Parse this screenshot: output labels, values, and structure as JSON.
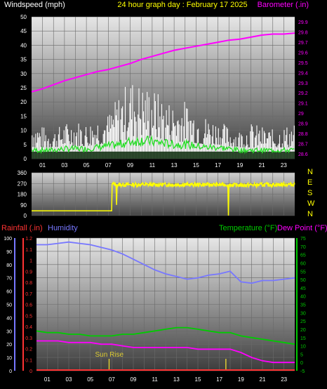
{
  "title": "24 hour graph day : February 17 2025",
  "colors": {
    "background": "#000000",
    "title": "#ffff00",
    "wind_axis": "#ffffff",
    "barometer": "#ff00ff",
    "direction": "#ffff00",
    "rainfall": "#ff3333",
    "humidity": "#7777ff",
    "temperature": "#00cc00",
    "dew_point": "#ff00ff",
    "gust": "#ffffff",
    "avg_wind": "#22dd22",
    "wind_dark": "#0a2a0a",
    "sunrise": "#ddcc33"
  },
  "x_tick_labels": [
    "01",
    "03",
    "05",
    "07",
    "09",
    "11",
    "13",
    "15",
    "17",
    "19",
    "21",
    "23"
  ],
  "chart_data": [
    {
      "type": "line",
      "name": "wind-barometer",
      "left_axis_label": "Windspeed (mph)",
      "right_axis_label": "Barometer (.in)",
      "left_ticks": [
        "0",
        "5",
        "10",
        "15",
        "20",
        "25",
        "30",
        "35",
        "40",
        "45",
        "50"
      ],
      "right_ticks": [
        "28.6",
        "28.7",
        "28.8",
        "28.9",
        "29",
        "29.1",
        "29.2",
        "29.3",
        "29.4",
        "29.5",
        "29.6",
        "29.7",
        "29.8",
        "29.9"
      ],
      "ylim_left": [
        0,
        50
      ],
      "ylim_right": [
        28.55,
        29.95
      ],
      "x_hours": [
        0,
        1,
        2,
        3,
        4,
        5,
        6,
        7,
        8,
        9,
        10,
        11,
        12,
        13,
        14,
        15,
        16,
        17,
        18,
        19,
        20,
        21,
        22,
        23,
        24
      ],
      "series": [
        {
          "name": "Barometer (.in)",
          "axis": "right",
          "values": [
            29.21,
            29.24,
            29.28,
            29.32,
            29.35,
            29.38,
            29.41,
            29.43,
            29.46,
            29.49,
            29.53,
            29.56,
            29.59,
            29.62,
            29.64,
            29.66,
            29.68,
            29.7,
            29.72,
            29.73,
            29.75,
            29.77,
            29.78,
            29.78,
            29.79
          ]
        },
        {
          "name": "Wind gust (mph)",
          "axis": "left",
          "values": [
            12,
            10,
            9,
            11,
            12,
            11,
            13,
            14,
            20,
            25,
            23,
            22,
            19,
            17,
            18,
            15,
            13,
            12,
            10,
            9,
            11,
            10,
            9,
            10,
            11
          ]
        },
        {
          "name": "Average wind (mph)",
          "axis": "left",
          "values": [
            3,
            3,
            3,
            3.5,
            3.5,
            3.5,
            4,
            4.5,
            5,
            6,
            6.5,
            6,
            5.5,
            5,
            5,
            4.5,
            4,
            4,
            3.5,
            3,
            3,
            3,
            3,
            3,
            3
          ]
        }
      ]
    },
    {
      "type": "line",
      "name": "wind-direction",
      "left_ticks": [
        "0",
        "90",
        "180",
        "270",
        "360"
      ],
      "right_ticks": [
        "N",
        "W",
        "S",
        "E",
        "N"
      ],
      "ylim": [
        0,
        360
      ],
      "series": [
        {
          "name": "Wind direction (deg)",
          "points": [
            [
              0,
              40
            ],
            [
              7.3,
              40
            ],
            [
              7.35,
              265
            ],
            [
              7.7,
              265
            ],
            [
              7.75,
              90
            ],
            [
              7.8,
              260
            ],
            [
              17.9,
              260
            ],
            [
              17.95,
              0
            ],
            [
              18.0,
              255
            ],
            [
              24,
              262
            ]
          ]
        }
      ]
    },
    {
      "type": "line",
      "name": "temp-humidity-rain",
      "left_axis_label_1": "Rainfall (.in)",
      "left_axis_label_2": "Humidity",
      "right_axis_label_1": "Temperature (°F)",
      "right_axis_label_2": "Dew Point (°F)",
      "humidity_ticks": [
        "0",
        "10",
        "20",
        "30",
        "40",
        "50",
        "60",
        "70",
        "80",
        "90",
        "100"
      ],
      "rain_ticks": [
        "0",
        "0.1",
        "0.2",
        "0.3",
        "0.4",
        "0.5",
        "0.6",
        "0.7",
        "0.8",
        "0.9",
        "1",
        "1.1",
        "1.2"
      ],
      "temp_ticks": [
        "-5",
        "0",
        "5",
        "10",
        "15",
        "20",
        "25",
        "30",
        "35",
        "40",
        "45",
        "50",
        "55",
        "60",
        "65",
        "70",
        "75"
      ],
      "ylim_humidity": [
        0,
        100
      ],
      "ylim_temperature": [
        -5,
        75
      ],
      "annotation": "Sun Rise",
      "sunrise_hour": 6.75,
      "sunset_hour": 17.6,
      "x_hours": [
        0,
        1,
        2,
        3,
        4,
        5,
        6,
        7,
        8,
        9,
        10,
        11,
        12,
        13,
        14,
        15,
        16,
        17,
        18,
        19,
        20,
        21,
        22,
        23,
        24
      ],
      "series": [
        {
          "name": "Humidity",
          "axis": "humidity",
          "values": [
            95,
            95,
            96,
            97,
            96,
            95,
            93,
            91,
            88,
            84,
            80,
            76,
            73,
            71,
            69,
            70,
            72,
            73,
            75,
            67,
            66,
            68,
            68,
            69,
            70
          ]
        },
        {
          "name": "Temperature (°F)",
          "axis": "temperature",
          "values": [
            19,
            18,
            18,
            17,
            17,
            16,
            16,
            16,
            17,
            17,
            18,
            19,
            20,
            21,
            21,
            20,
            19,
            18,
            18,
            16,
            15,
            14,
            13,
            12,
            11
          ]
        },
        {
          "name": "Dew Point (°F)",
          "axis": "temperature",
          "values": [
            13,
            13,
            13,
            12,
            12,
            12,
            11,
            11,
            10,
            9,
            9,
            9,
            9,
            9,
            9,
            8,
            8,
            8,
            8,
            6,
            3,
            1,
            0,
            0,
            0
          ]
        },
        {
          "name": "Rainfall (.in)",
          "axis": "rain",
          "values": [
            0,
            0,
            0,
            0,
            0,
            0,
            0,
            0,
            0,
            0,
            0,
            0,
            0,
            0,
            0,
            0,
            0,
            0,
            0,
            0,
            0,
            0,
            0,
            0,
            0
          ]
        }
      ]
    }
  ]
}
